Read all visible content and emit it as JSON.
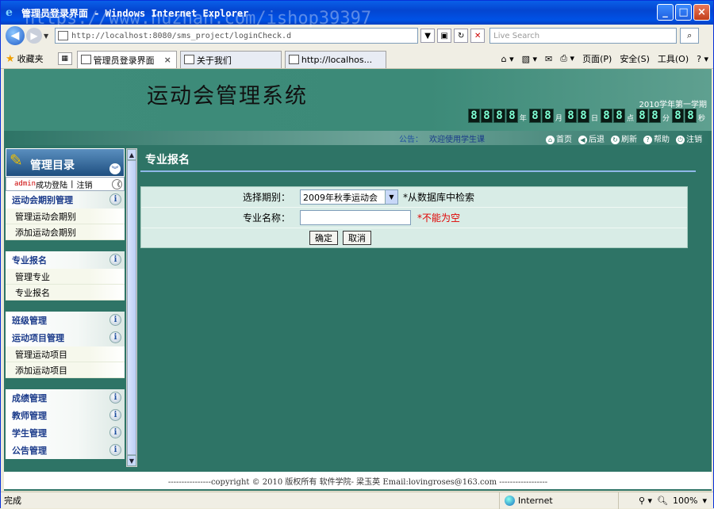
{
  "window": {
    "title": "管理员登录界面 - Windows Internet Explorer"
  },
  "watermark": "https://www.huzhan.com/ishop39397",
  "address": {
    "url": "http://localhost:8080/sms_project/loginCheck.d",
    "search_placeholder": "Live Search"
  },
  "favorites": {
    "label": "收藏夹"
  },
  "tabs": [
    {
      "label": "管理员登录界面"
    },
    {
      "label": "关于我们"
    },
    {
      "label": "http://localhos..."
    }
  ],
  "tools": {
    "page": "页面(P)",
    "safety": "安全(S)",
    "tools": "工具(O)"
  },
  "banner": {
    "title": "运动会管理系统",
    "term": "2010学年第一学期",
    "clock": [
      {
        "digits": [
          "8",
          "8",
          "8",
          "8"
        ],
        "unit": "年"
      },
      {
        "digits": [
          "8",
          "8"
        ],
        "unit": "月"
      },
      {
        "digits": [
          "8",
          "8"
        ],
        "unit": "日"
      },
      {
        "digits": [
          "8",
          "8"
        ],
        "unit": "点"
      },
      {
        "digits": [
          "8",
          "8"
        ],
        "unit": "分"
      },
      {
        "digits": [
          "8",
          "8"
        ],
        "unit": "秒"
      }
    ]
  },
  "notice": {
    "label": "公告：",
    "text": "欢迎使用学生课"
  },
  "quick": [
    "首页",
    "后退",
    "刷新",
    "帮助",
    "注销"
  ],
  "sidebar": {
    "title": "管理目录",
    "login_user": "admin",
    "login_text": "成功登陆",
    "logout": "注销",
    "groups": [
      {
        "title": "运动会期别管理",
        "items": [
          "管理运动会期别",
          "添加运动会期别"
        ]
      },
      {
        "title": "专业报名",
        "items": [
          "管理专业",
          "专业报名"
        ]
      },
      {
        "title": "班级管理",
        "items": []
      },
      {
        "title": "运动项目管理",
        "items": [
          "管理运动项目",
          "添加运动项目"
        ]
      },
      {
        "title": "成绩管理",
        "items": []
      },
      {
        "title": "教师管理",
        "items": []
      },
      {
        "title": "学生管理",
        "items": []
      },
      {
        "title": "公告管理",
        "items": []
      }
    ]
  },
  "main": {
    "title": "专业报名",
    "period_label": "选择期别：",
    "period_value": "2009年秋季运动会",
    "period_hint": "*从数据库中检索",
    "major_label": "专业名称：",
    "major_value": "",
    "major_hint": "*不能为空",
    "ok": "确定",
    "cancel": "取消"
  },
  "footer": "----------------copyright © 2010 版权所有 软件学院- 梁玉英  Email:lovingroses@163.com  ------------------",
  "status": {
    "left": "完成",
    "zone": "Internet",
    "zoom": "100%"
  }
}
